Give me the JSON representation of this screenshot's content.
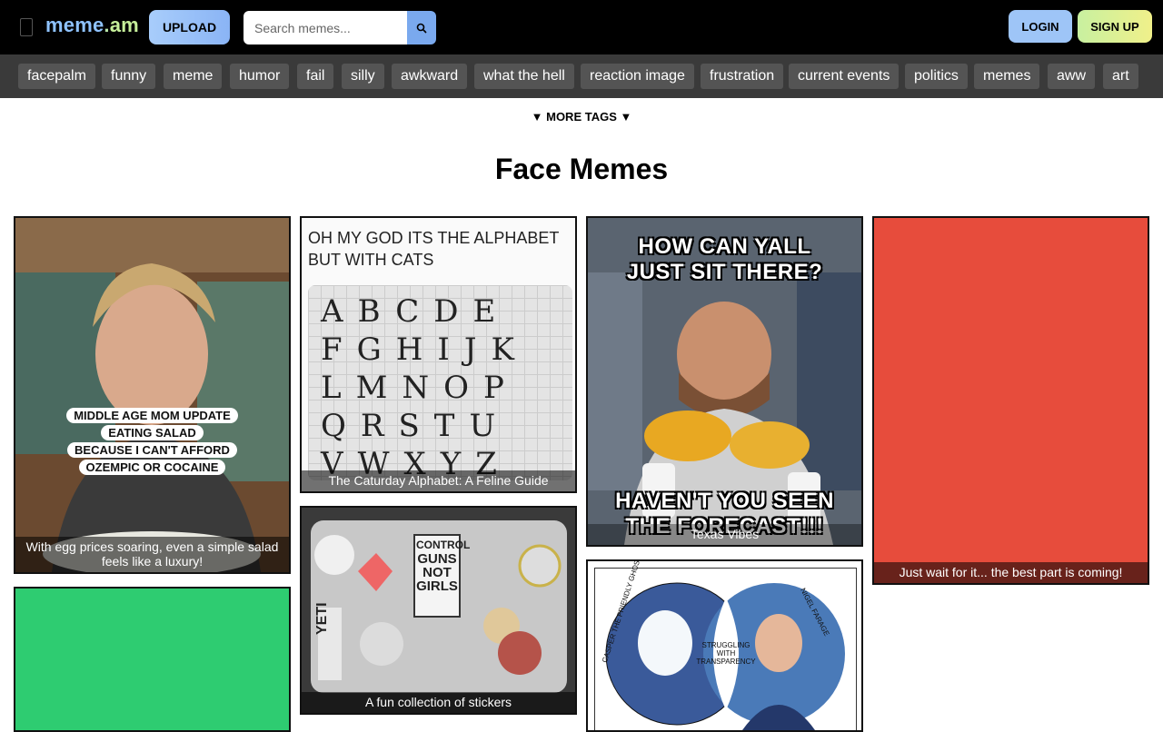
{
  "header": {
    "logo_main": "meme",
    "logo_dot": ".",
    "logo_tld": "am",
    "upload_label": "UPLOAD",
    "search_placeholder": "Search memes...",
    "login_label": "LOGIN",
    "signup_label": "SIGN UP"
  },
  "tags": [
    "facepalm",
    "funny",
    "meme",
    "humor",
    "fail",
    "silly",
    "awkward",
    "what the hell",
    "reaction image",
    "frustration",
    "current events",
    "politics",
    "memes",
    "aww",
    "art"
  ],
  "more_tags_label": "▼ MORE TAGS ▼",
  "page_title": "Face Memes",
  "cards": {
    "salad": {
      "caption": "With egg prices soaring, even a simple salad feels like a luxury!",
      "lines": [
        "MIDDLE AGE MOM UPDATE",
        "EATING SALAD",
        "BECAUSE I CAN'T AFFORD",
        "OZEMPIC OR COCAINE"
      ]
    },
    "alphabet": {
      "caption": "The Caturday Alphabet: A Feline Guide",
      "heading_line1": "OH MY GOD ITS THE ALPHABET",
      "heading_line2": "BUT WITH CATS",
      "letters": [
        "A",
        "B",
        "C",
        "D",
        "E",
        "F",
        "G",
        "H",
        "I",
        "J",
        "K",
        "L",
        "M",
        "N",
        "O",
        "P",
        "Q",
        "R",
        "S",
        "T",
        "U",
        "V",
        "W",
        "X",
        "Y",
        "Z"
      ]
    },
    "texas": {
      "caption": "Texas Vibes",
      "top_line1": "HOW CAN YALL",
      "top_line2": "JUST SIT THERE?",
      "bottom_line1": "HAVEN'T YOU SEEN",
      "bottom_line2": "THE FORECAST!!!"
    },
    "red": {
      "caption": "Just wait for it... the best part is coming!",
      "color": "#e74c3c"
    },
    "green": {
      "color": "#2ecc71"
    },
    "stickers": {
      "caption": "A fun collection of stickers",
      "sign_line1": "CONTROL",
      "sign_line2": "GUNS",
      "sign_line3": "NOT",
      "sign_line4": "GIRLS",
      "brand": "YETI"
    },
    "venn": {
      "left_label": "CASPER THE FRIENDLY GHOST",
      "right_label": "NIGEL FARAGE",
      "center_line1": "STRUGGLING",
      "center_line2": "WITH",
      "center_line3": "TRANSPARENCY"
    }
  }
}
